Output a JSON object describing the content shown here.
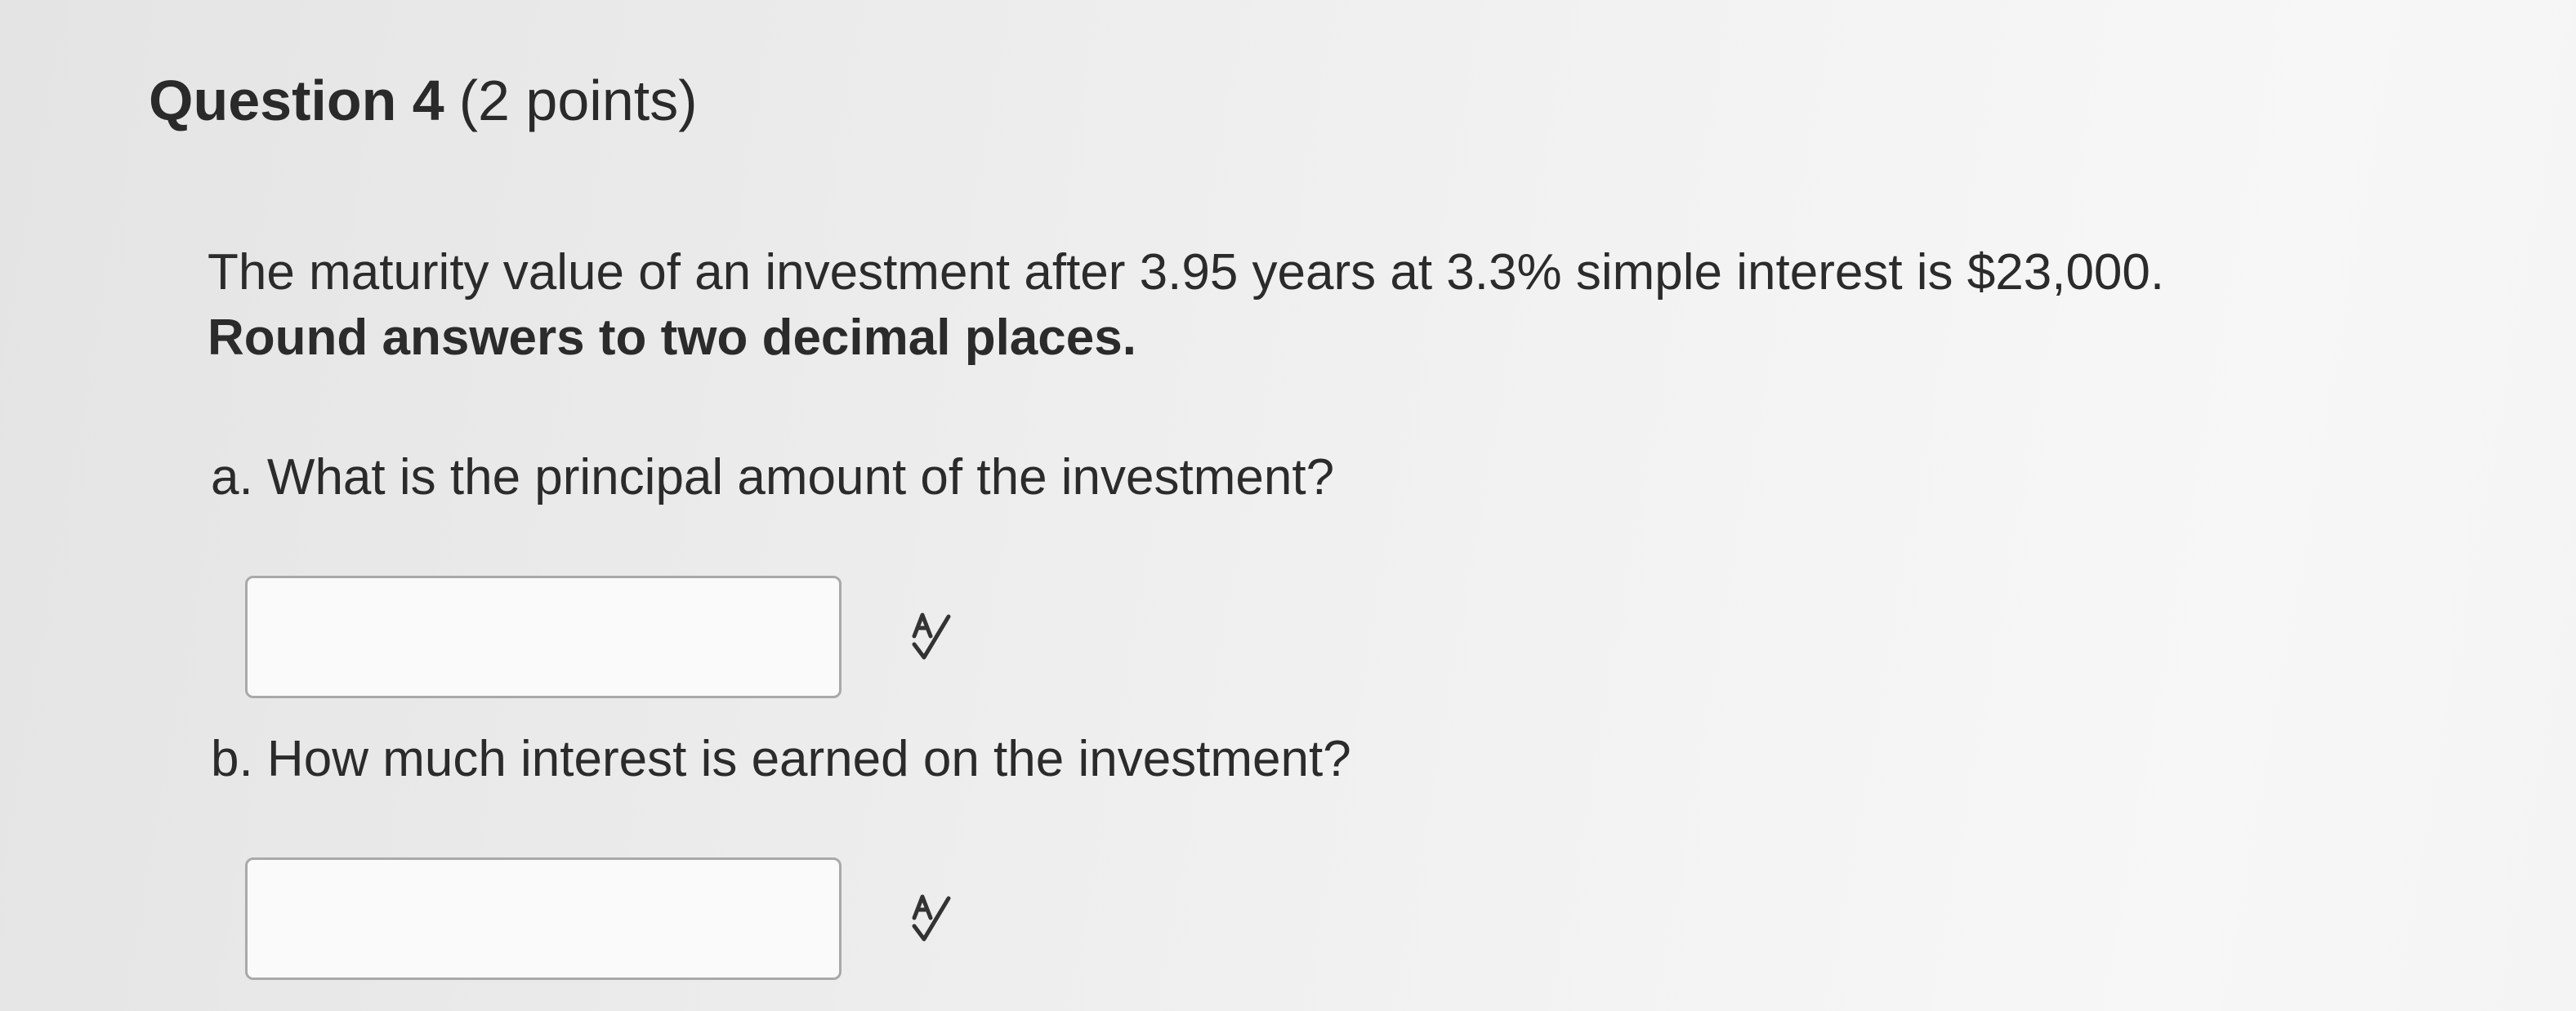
{
  "question": {
    "name": "Question 4",
    "points": "(2 points)"
  },
  "stem": {
    "text": "The maturity value of an investment after 3.95 years at 3.3% simple interest is $23,000.",
    "instruction": "Round answers to two decimal places."
  },
  "parts": [
    {
      "label": "a. What is the principal amount of the investment?",
      "answer_value": "",
      "answer_placeholder": "",
      "icon": "spell-check-icon"
    },
    {
      "label": "b. How much interest is earned on the investment?",
      "answer_value": "",
      "answer_placeholder": "",
      "icon": "spell-check-icon"
    }
  ],
  "colors": {
    "text": "#2b2b2b",
    "input_border": "#a9a9a9",
    "background": "#eeeeee"
  }
}
